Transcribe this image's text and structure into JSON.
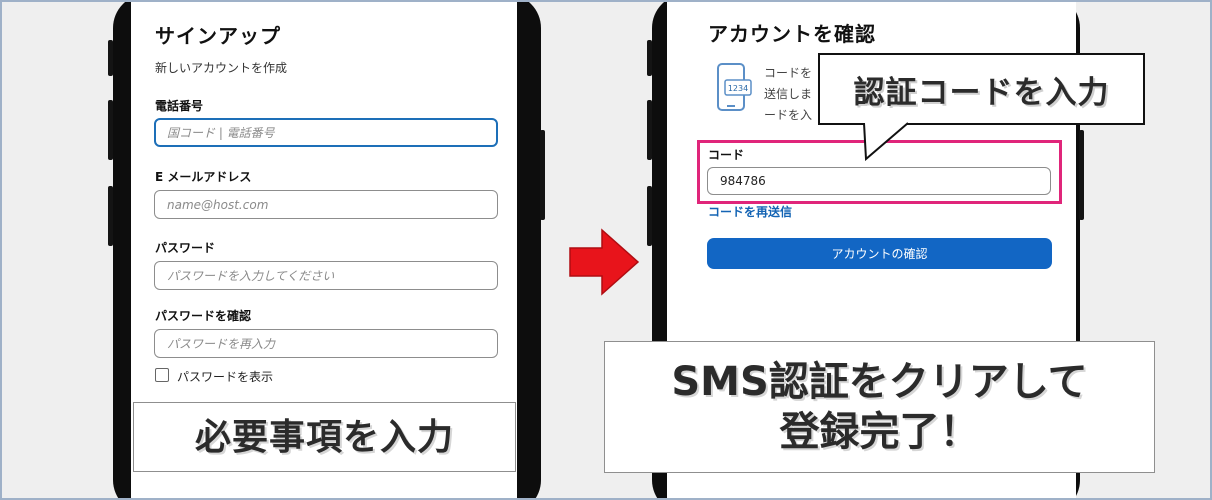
{
  "signup": {
    "title": "サインアップ",
    "subtitle": "新しいアカウントを作成",
    "phone_label": "電話番号",
    "phone_placeholder": "国コード | 電話番号",
    "email_label": "E メールアドレス",
    "email_placeholder": "name@host.com",
    "password_label": "パスワード",
    "password_placeholder": "パスワードを入力してください",
    "confirm_label": "パスワードを確認",
    "confirm_placeholder": "パスワードを再入力",
    "show_password_label": "パスワードを表示"
  },
  "caption_left": "必要事項を入力",
  "arrow_icon": "right-arrow-icon",
  "verify": {
    "title": "アカウントを確認",
    "message_lines": [
      "コードを",
      "送信しま",
      "ードを入"
    ],
    "code_label": "コード",
    "code_value": "984786",
    "resend_label": "コードを再送信",
    "confirm_button": "アカウントの確認",
    "icon_digits": "1234"
  },
  "callout": "認証コードを入力",
  "caption_right_line1": "SMS認証をクリアして",
  "caption_right_line2": "登録完了！",
  "colors": {
    "accent_blue": "#1266c4",
    "link_blue": "#1464b4",
    "highlight_pink": "#e0257a",
    "arrow_red": "#e8141b"
  }
}
